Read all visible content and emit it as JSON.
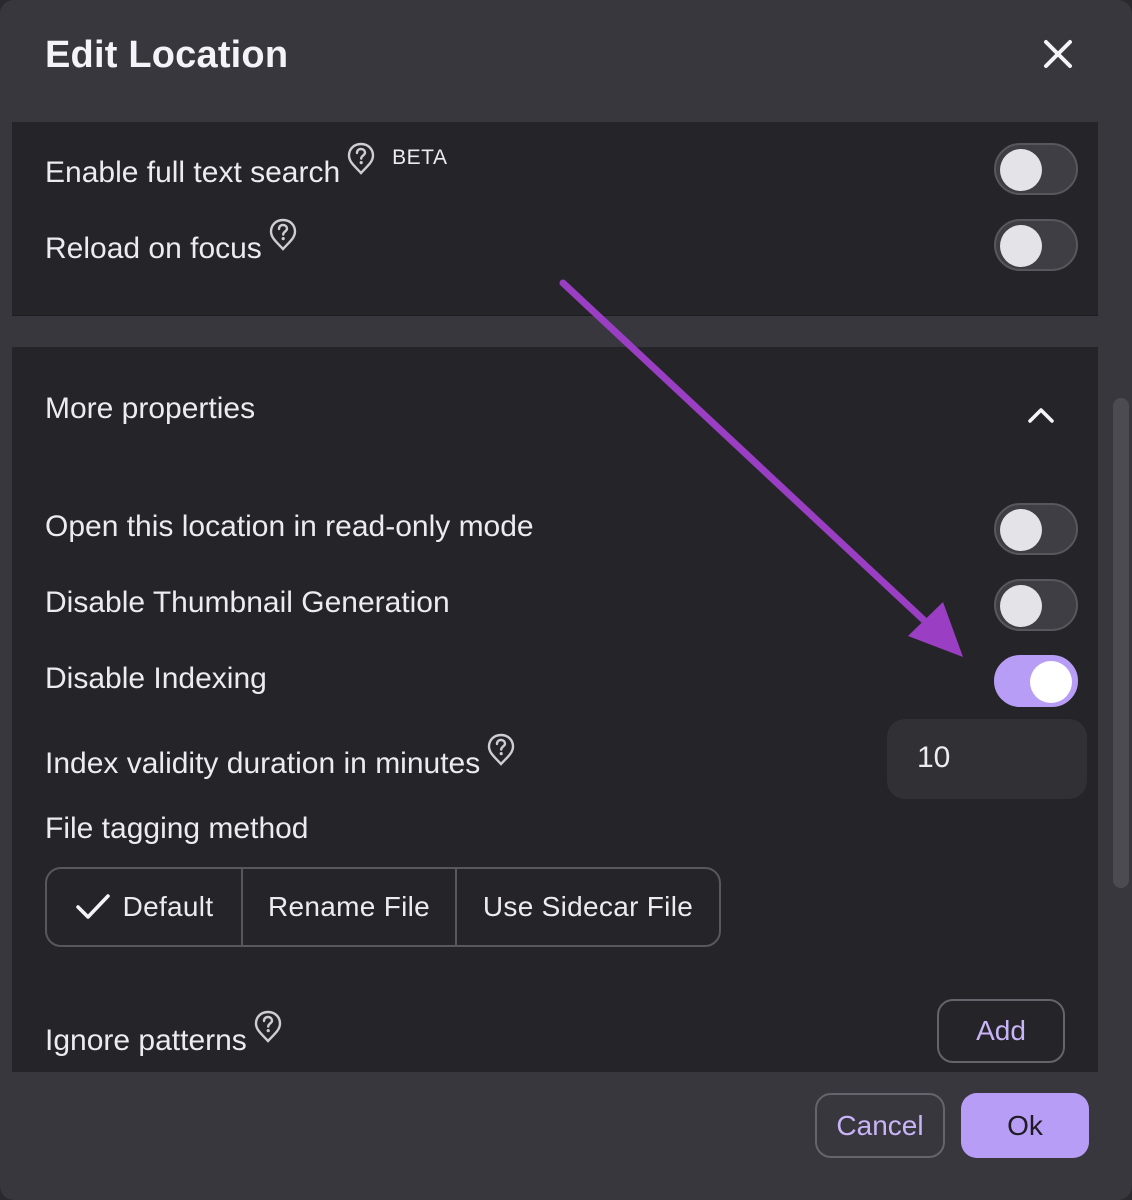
{
  "dialog": {
    "title": "Edit Location"
  },
  "top_settings": [
    {
      "label": "Enable full text search",
      "badge": "BETA",
      "on": false
    },
    {
      "label": "Reload on focus",
      "on": false
    }
  ],
  "more_properties": {
    "title": "More properties",
    "toggles": [
      {
        "label": "Open this location in read-only mode",
        "on": false
      },
      {
        "label": "Disable Thumbnail Generation",
        "on": false
      },
      {
        "label": "Disable Indexing",
        "on": true
      }
    ],
    "index_validity": {
      "label": "Index validity duration in minutes",
      "value": "10"
    },
    "tagging": {
      "label": "File tagging method",
      "options": [
        "Default",
        "Rename File",
        "Use Sidecar File"
      ],
      "selected": "Default"
    },
    "ignore_patterns": {
      "label": "Ignore patterns",
      "add_label": "Add"
    }
  },
  "footer": {
    "cancel_label": "Cancel",
    "ok_label": "Ok"
  },
  "colors": {
    "accent": "#b79df5",
    "annotation_arrow": "#9a3fc4"
  }
}
